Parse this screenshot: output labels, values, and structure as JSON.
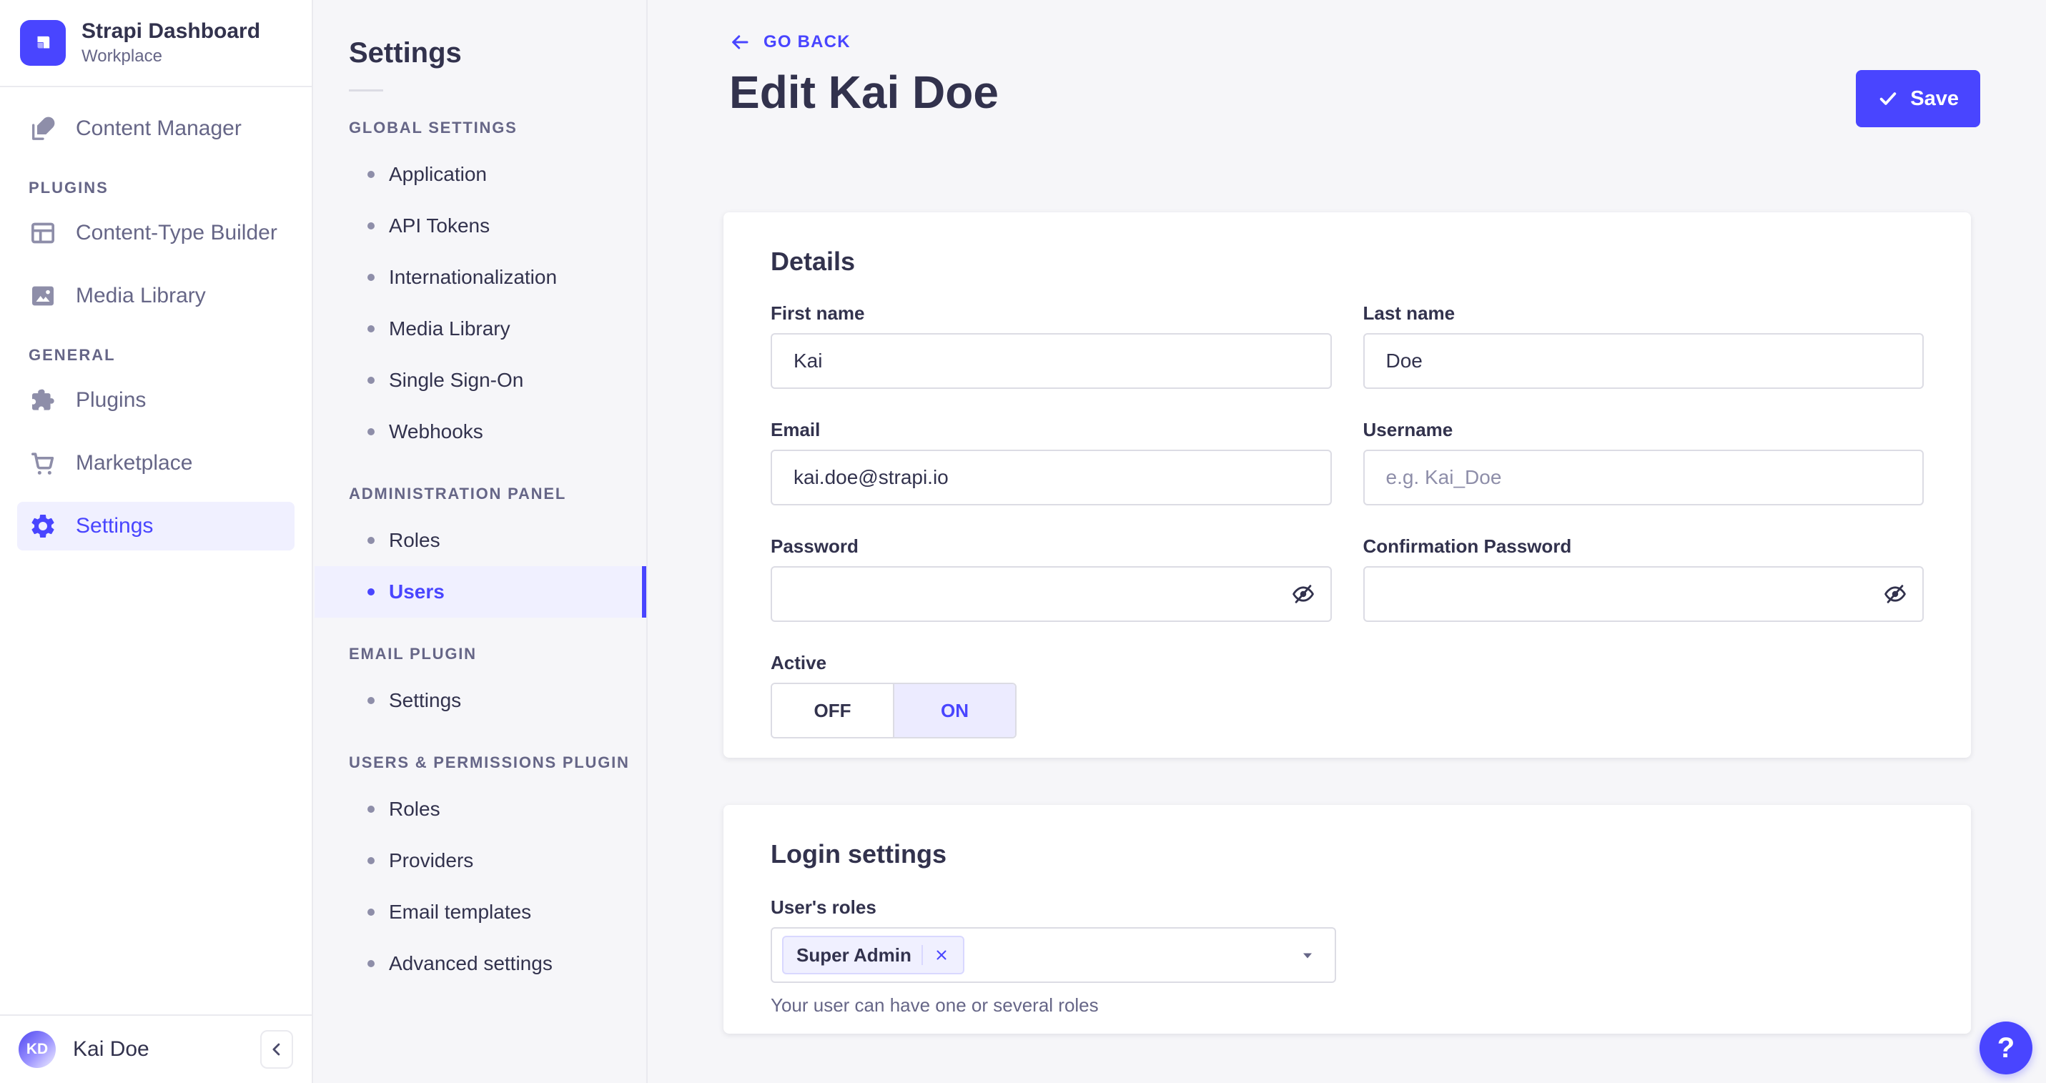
{
  "colors": {
    "primary": "#4945ff",
    "primary_light": "#f0f0ff",
    "chip_border": "#d9d8ff",
    "background": "#f6f6f9",
    "text_dark": "#32324d",
    "text_muted": "#666687"
  },
  "sidebar": {
    "title": "Strapi Dashboard",
    "subtitle": "Workplace",
    "content_manager": "Content Manager",
    "plugins_header": "PLUGINS",
    "content_type_builder": "Content-Type Builder",
    "media_library": "Media Library",
    "general_header": "GENERAL",
    "plugins": "Plugins",
    "marketplace": "Marketplace",
    "settings": "Settings",
    "user": {
      "initials": "KD",
      "name": "Kai Doe"
    }
  },
  "subnav": {
    "title": "Settings",
    "active_item": "Users",
    "sections": [
      {
        "header": "GLOBAL SETTINGS",
        "items": [
          "Application",
          "API Tokens",
          "Internationalization",
          "Media Library",
          "Single Sign-On",
          "Webhooks"
        ]
      },
      {
        "header": "ADMINISTRATION PANEL",
        "items": [
          "Roles",
          "Users"
        ]
      },
      {
        "header": "EMAIL PLUGIN",
        "items": [
          "Settings"
        ]
      },
      {
        "header": "USERS & PERMISSIONS PLUGIN",
        "items": [
          "Roles",
          "Providers",
          "Email templates",
          "Advanced settings"
        ]
      }
    ]
  },
  "header": {
    "go_back": "GO BACK",
    "title": "Edit Kai Doe",
    "save": "Save"
  },
  "details": {
    "title": "Details",
    "first_name": {
      "label": "First name",
      "value": "Kai"
    },
    "last_name": {
      "label": "Last name",
      "value": "Doe"
    },
    "email": {
      "label": "Email",
      "value": "kai.doe@strapi.io"
    },
    "username": {
      "label": "Username",
      "value": "",
      "placeholder": "e.g. Kai_Doe"
    },
    "password": {
      "label": "Password",
      "value": ""
    },
    "confirmation_password": {
      "label": "Confirmation Password",
      "value": ""
    },
    "active": {
      "label": "Active",
      "off": "OFF",
      "on": "ON",
      "selected": "ON"
    }
  },
  "login": {
    "title": "Login settings",
    "roles_label": "User's roles",
    "selected_role": "Super Admin",
    "helper": "Your user can have one or several roles"
  },
  "help": {
    "label": "?"
  }
}
